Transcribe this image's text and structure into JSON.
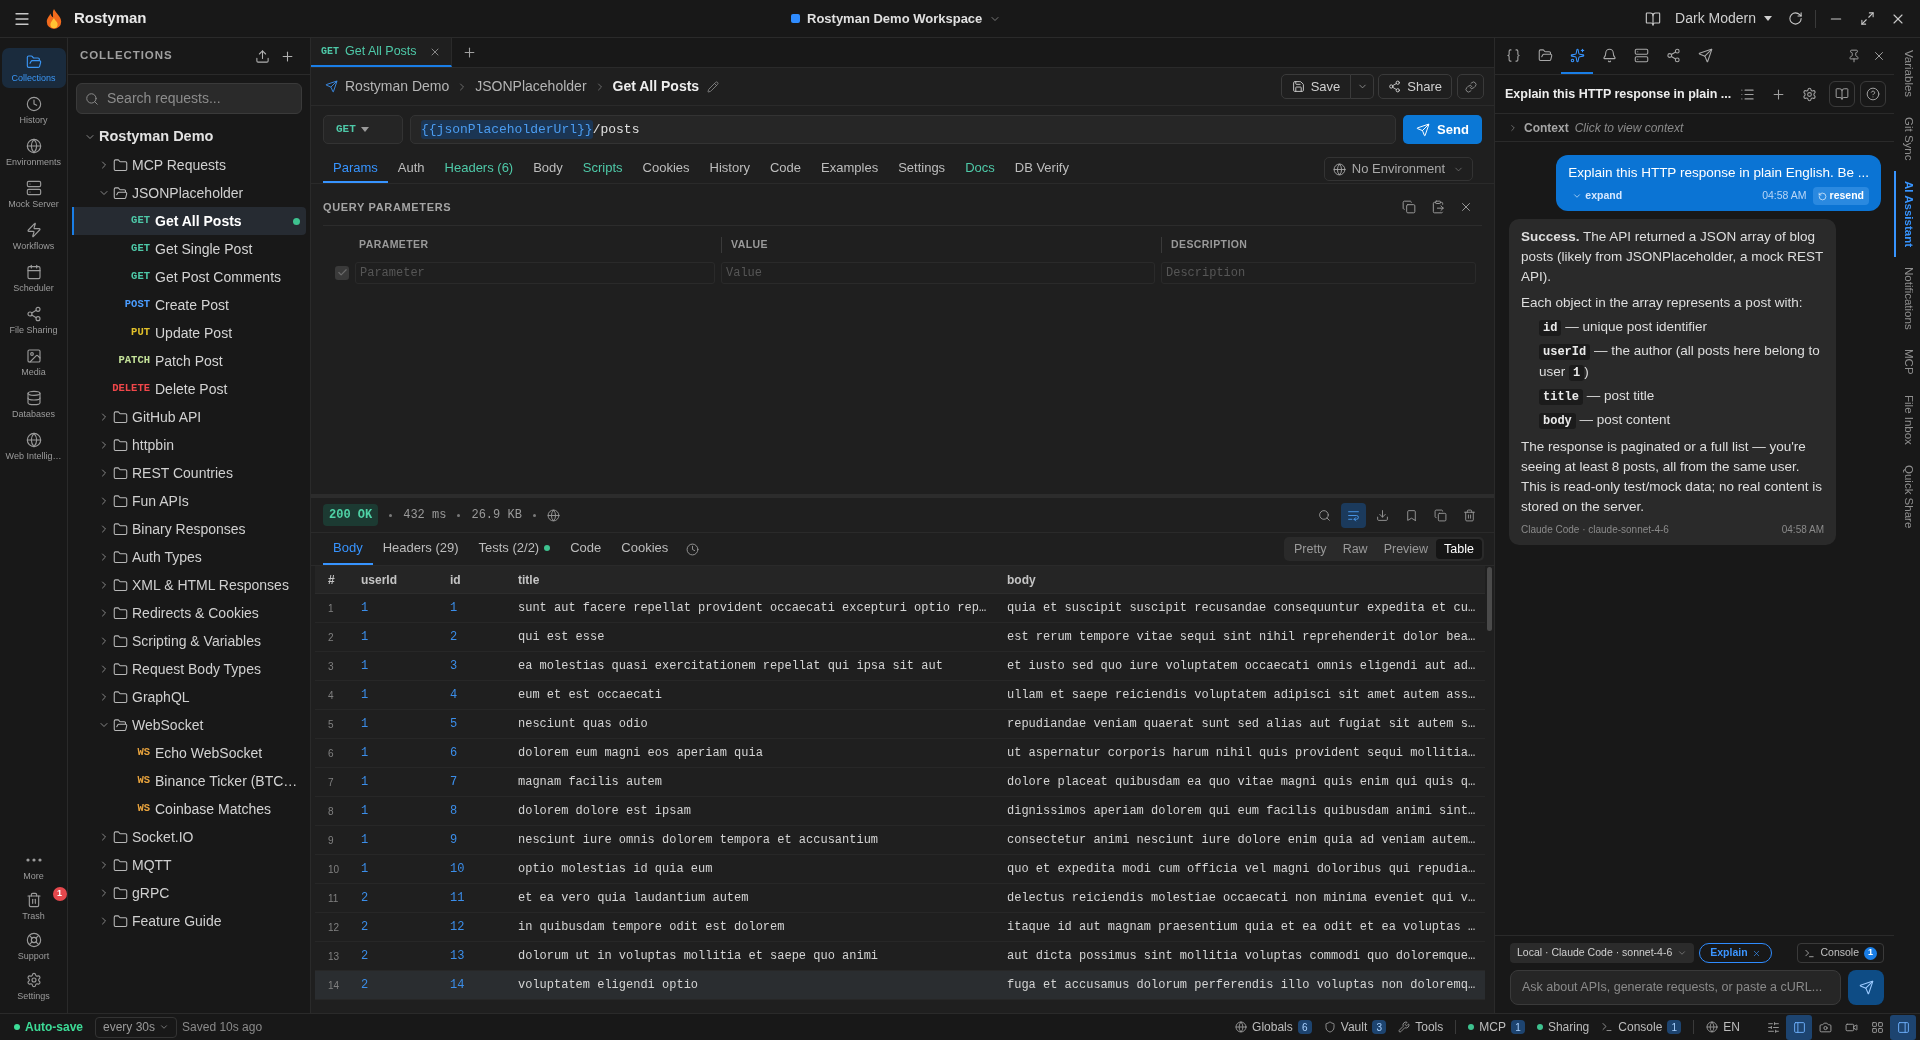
{
  "title_bar": {
    "app_name": "Rostyman",
    "workspace": "Rostyman Demo Workspace",
    "theme": "Dark Modern"
  },
  "activity_bar": {
    "items": [
      {
        "label": "Collections",
        "selected": true
      },
      {
        "label": "History",
        "selected": false
      },
      {
        "label": "Environments",
        "selected": false
      },
      {
        "label": "Mock Server",
        "selected": false
      },
      {
        "label": "Workflows",
        "selected": false
      },
      {
        "label": "Scheduler",
        "selected": false
      },
      {
        "label": "File Sharing",
        "selected": false
      },
      {
        "label": "Media",
        "selected": false
      },
      {
        "label": "Databases",
        "selected": false
      },
      {
        "label": "Web Intellig…",
        "selected": false
      }
    ],
    "bottom_items": [
      {
        "label": "More"
      },
      {
        "label": "Trash",
        "badge": "1"
      },
      {
        "label": "Support"
      },
      {
        "label": "Settings"
      }
    ]
  },
  "collections": {
    "title": "COLLECTIONS",
    "search_placeholder": "Search requests...",
    "tree": [
      {
        "kind": "collection",
        "label": "Rostyman Demo",
        "expanded": true,
        "children": [
          {
            "kind": "folder",
            "label": "MCP Requests",
            "expanded": false
          },
          {
            "kind": "folder",
            "label": "JSONPlaceholder",
            "expanded": true,
            "children": [
              {
                "kind": "request",
                "method": "GET",
                "color": "#4ec9a8",
                "label": "Get All Posts",
                "selected": true,
                "status_dot": true
              },
              {
                "kind": "request",
                "method": "GET",
                "color": "#4ec9a8",
                "label": "Get Single Post",
                "selected": false,
                "status_dot": false
              },
              {
                "kind": "request",
                "method": "GET",
                "color": "#4ec9a8",
                "label": "Get Post Comments",
                "selected": false,
                "status_dot": false
              },
              {
                "kind": "request",
                "method": "POST",
                "color": "#4b9dff",
                "label": "Create Post",
                "selected": false,
                "status_dot": false
              },
              {
                "kind": "request",
                "method": "PUT",
                "color": "#e2c12a",
                "label": "Update Post",
                "selected": false,
                "status_dot": false
              },
              {
                "kind": "request",
                "method": "PATCH",
                "color": "#c5e39a",
                "label": "Patch Post",
                "selected": false,
                "status_dot": false
              },
              {
                "kind": "request",
                "method": "DELETE",
                "color": "#f0474a",
                "label": "Delete Post",
                "selected": false,
                "status_dot": false
              }
            ]
          },
          {
            "kind": "folder",
            "label": "GitHub API",
            "expanded": false
          },
          {
            "kind": "folder",
            "label": "httpbin",
            "expanded": false
          },
          {
            "kind": "folder",
            "label": "REST Countries",
            "expanded": false
          },
          {
            "kind": "folder",
            "label": "Fun APIs",
            "expanded": false
          },
          {
            "kind": "folder",
            "label": "Binary Responses",
            "expanded": false
          },
          {
            "kind": "folder",
            "label": "Auth Types",
            "expanded": false
          },
          {
            "kind": "folder",
            "label": "XML & HTML Responses",
            "expanded": false
          },
          {
            "kind": "folder",
            "label": "Redirects & Cookies",
            "expanded": false
          },
          {
            "kind": "folder",
            "label": "Scripting & Variables",
            "expanded": false
          },
          {
            "kind": "folder",
            "label": "Request Body Types",
            "expanded": false
          },
          {
            "kind": "folder",
            "label": "GraphQL",
            "expanded": false
          },
          {
            "kind": "folder",
            "label": "WebSocket",
            "expanded": true,
            "children": [
              {
                "kind": "request",
                "method": "WS",
                "color": "#e8a33d",
                "label": "Echo WebSocket",
                "selected": false,
                "status_dot": false
              },
              {
                "kind": "request",
                "method": "WS",
                "color": "#e8a33d",
                "label": "Binance Ticker (BTC…",
                "selected": false,
                "status_dot": false
              },
              {
                "kind": "request",
                "method": "WS",
                "color": "#e8a33d",
                "label": "Coinbase Matches",
                "selected": false,
                "status_dot": false
              }
            ]
          },
          {
            "kind": "folder",
            "label": "Socket.IO",
            "expanded": false
          },
          {
            "kind": "folder",
            "label": "MQTT",
            "expanded": false
          },
          {
            "kind": "folder",
            "label": "gRPC",
            "expanded": false
          },
          {
            "kind": "folder",
            "label": "Feature Guide",
            "expanded": false
          }
        ]
      }
    ]
  },
  "open_tabs": [
    {
      "method": "GET",
      "label": "Get All Posts",
      "selected": true
    }
  ],
  "breadcrumb": {
    "items": [
      "Rostyman Demo",
      "JSONPlaceholder"
    ],
    "current": "Get All Posts"
  },
  "actions": {
    "save": "Save",
    "share": "Share"
  },
  "url_bar": {
    "method": "GET",
    "parts": [
      {
        "kind": "variable",
        "text": "{{jsonPlaceholderUrl}}"
      },
      {
        "kind": "text",
        "text": "/posts"
      }
    ],
    "send": "Send"
  },
  "request_sections": [
    {
      "label": "Params",
      "selected": true,
      "has_content": false
    },
    {
      "label": "Auth",
      "selected": false,
      "has_content": false
    },
    {
      "label": "Headers (6)",
      "selected": false,
      "has_content": true
    },
    {
      "label": "Body",
      "selected": false,
      "has_content": false
    },
    {
      "label": "Scripts",
      "selected": false,
      "has_content": true
    },
    {
      "label": "Cookies",
      "selected": false,
      "has_content": false
    },
    {
      "label": "History",
      "selected": false,
      "has_content": false
    },
    {
      "label": "Code",
      "selected": false,
      "has_content": false
    },
    {
      "label": "Examples",
      "selected": false,
      "has_content": false
    },
    {
      "label": "Settings",
      "selected": false,
      "has_content": false
    },
    {
      "label": "Docs",
      "selected": false,
      "has_content": true
    },
    {
      "label": "DB Verify",
      "selected": false,
      "has_content": false
    }
  ],
  "environment": "No Environment",
  "query_parameters": {
    "title": "QUERY PARAMETERS",
    "columns": [
      "PARAMETER",
      "VALUE",
      "DESCRIPTION"
    ],
    "new_row": {
      "checked": true,
      "placeholders": [
        "Parameter",
        "Value",
        "Description"
      ]
    }
  },
  "response": {
    "status": "200 OK",
    "time": "432 ms",
    "size": "26.9 KB",
    "word_wrap": true,
    "tabs": [
      {
        "label": "Body",
        "selected": true,
        "dot": false
      },
      {
        "label": "Headers (29)",
        "selected": false,
        "dot": false
      },
      {
        "label": "Tests (2/2)",
        "selected": false,
        "dot": true
      },
      {
        "label": "Code",
        "selected": false,
        "dot": false
      },
      {
        "label": "Cookies",
        "selected": false,
        "dot": false
      }
    ],
    "views": [
      {
        "label": "Pretty",
        "selected": false
      },
      {
        "label": "Raw",
        "selected": false
      },
      {
        "label": "Preview",
        "selected": false
      },
      {
        "label": "Table",
        "selected": true
      }
    ],
    "table": {
      "columns": [
        "#",
        "userId",
        "id",
        "title",
        "body"
      ],
      "rows": [
        {
          "cells": [
            "1",
            "1",
            "1",
            "sunt aut facere repellat provident occaecati excepturi optio rep…",
            "quia et suscipit suscipit recusandae consequuntur expedita et cu…"
          ],
          "highlighted": false
        },
        {
          "cells": [
            "2",
            "1",
            "2",
            "qui est esse",
            "est rerum tempore vitae sequi sint nihil reprehenderit dolor bea…"
          ],
          "highlighted": false
        },
        {
          "cells": [
            "3",
            "1",
            "3",
            "ea molestias quasi exercitationem repellat qui ipsa sit aut",
            "et iusto sed quo iure voluptatem occaecati omnis eligendi aut ad…"
          ],
          "highlighted": false
        },
        {
          "cells": [
            "4",
            "1",
            "4",
            "eum et est occaecati",
            "ullam et saepe reiciendis voluptatem adipisci sit amet autem ass…"
          ],
          "highlighted": false
        },
        {
          "cells": [
            "5",
            "1",
            "5",
            "nesciunt quas odio",
            "repudiandae veniam quaerat sunt sed alias aut fugiat sit autem s…"
          ],
          "highlighted": false
        },
        {
          "cells": [
            "6",
            "1",
            "6",
            "dolorem eum magni eos aperiam quia",
            "ut aspernatur corporis harum nihil quis provident sequi mollitia…"
          ],
          "highlighted": false
        },
        {
          "cells": [
            "7",
            "1",
            "7",
            "magnam facilis autem",
            "dolore placeat quibusdam ea quo vitae magni quis enim qui quis q…"
          ],
          "highlighted": false
        },
        {
          "cells": [
            "8",
            "1",
            "8",
            "dolorem dolore est ipsam",
            "dignissimos aperiam dolorem qui eum facilis quibusdam animi sint…"
          ],
          "highlighted": false
        },
        {
          "cells": [
            "9",
            "1",
            "9",
            "nesciunt iure omnis dolorem tempora et accusantium",
            "consectetur animi nesciunt iure dolore enim quia ad veniam autem…"
          ],
          "highlighted": false
        },
        {
          "cells": [
            "10",
            "1",
            "10",
            "optio molestias id quia eum",
            "quo et expedita modi cum officia vel magni doloribus qui repudia…"
          ],
          "highlighted": false
        },
        {
          "cells": [
            "11",
            "2",
            "11",
            "et ea vero quia laudantium autem",
            "delectus reiciendis molestiae occaecati non minima eveniet qui v…"
          ],
          "highlighted": false
        },
        {
          "cells": [
            "12",
            "2",
            "12",
            "in quibusdam tempore odit est dolorem",
            "itaque id aut magnam praesentium quia et ea odit et ea voluptas …"
          ],
          "highlighted": false
        },
        {
          "cells": [
            "13",
            "2",
            "13",
            "dolorum ut in voluptas mollitia et saepe quo animi",
            "aut dicta possimus sint mollitia voluptas commodi quo doloremque…"
          ],
          "highlighted": false
        },
        {
          "cells": [
            "14",
            "2",
            "14",
            "voluptatem eligendi optio",
            "fuga et accusamus dolorum perferendis illo voluptas non doloremq…"
          ],
          "highlighted": true
        }
      ]
    }
  },
  "ai_panel": {
    "tools": [
      {
        "selected": false
      },
      {
        "selected": false
      },
      {
        "selected": true
      },
      {
        "selected": false
      },
      {
        "selected": false
      },
      {
        "selected": false
      },
      {
        "selected": false
      }
    ],
    "chat_title": "Explain this HTTP response in plain ...",
    "context": {
      "label": "Context",
      "hint": "Click to view context",
      "expanded": false
    },
    "messages": [
      {
        "kind": "user",
        "text": "Explain this HTTP response in plain English. Be ...",
        "expand": "expand",
        "time": "04:58 AM",
        "resend": "resend"
      },
      {
        "kind": "assistant",
        "blocks": [
          {
            "kind": "paragraph",
            "text": "**Success.** The API returned a JSON array of blog posts (likely from JSONPlaceholder, a mock REST API)."
          },
          {
            "kind": "paragraph",
            "text": "Each object in the array represents a post with:"
          },
          {
            "kind": "list",
            "items": [
              {
                "parts": [
                  {
                    "kind": "code",
                    "text": "id"
                  },
                  {
                    "kind": "text",
                    "text": " — unique post identifier"
                  }
                ]
              },
              {
                "parts": [
                  {
                    "kind": "code",
                    "text": "userId"
                  },
                  {
                    "kind": "text",
                    "text": " — the author (all posts here belong to user "
                  },
                  {
                    "kind": "code",
                    "text": "1"
                  },
                  {
                    "kind": "text",
                    "text": ")"
                  }
                ]
              },
              {
                "parts": [
                  {
                    "kind": "code",
                    "text": "title"
                  },
                  {
                    "kind": "text",
                    "text": " — post title"
                  }
                ]
              },
              {
                "parts": [
                  {
                    "kind": "code",
                    "text": "body"
                  },
                  {
                    "kind": "text",
                    "text": " — post content"
                  }
                ]
              }
            ]
          },
          {
            "kind": "paragraph",
            "text": "The response is paginated or a full list — you're seeing at least 8 posts, all from the same user. This is read-only test/mock data; no real content is stored on the server."
          }
        ],
        "footer": "Claude Code · claude-sonnet-4-6",
        "time": "04:58 AM"
      }
    ],
    "composer": {
      "model": "Local · Claude Code · sonnet-4-6",
      "mode": "Explain",
      "console": "Console",
      "console_count": "1",
      "placeholder": "Ask about APIs, generate requests, or paste a cURL..."
    }
  },
  "side_tabs": [
    {
      "label": "Variables",
      "selected": false
    },
    {
      "label": "Git Sync",
      "selected": false
    },
    {
      "label": "AI Assistant",
      "selected": true
    },
    {
      "label": "Notifications",
      "selected": false
    },
    {
      "label": "MCP",
      "selected": false
    },
    {
      "label": "File Inbox",
      "selected": false
    },
    {
      "label": "Quick Share",
      "selected": false
    }
  ],
  "status_bar": {
    "autosave": "Auto-save",
    "autosave_on": true,
    "interval": "every 30s",
    "saved": "Saved 10s ago",
    "groups": [
      [
        {
          "label": "Globals",
          "count": "6",
          "dot": false
        },
        {
          "label": "Vault",
          "count": "3",
          "dot": false
        },
        {
          "label": "Tools",
          "dot": false
        }
      ],
      [
        {
          "label": "MCP",
          "count": "1",
          "dot": true
        },
        {
          "label": "Sharing",
          "dot": true
        },
        {
          "label": "Console",
          "count": "1",
          "dot": false
        }
      ],
      [
        {
          "label": "EN",
          "dot": false
        }
      ]
    ],
    "layout_toggles": [
      {
        "selected": false
      },
      {
        "selected": true
      },
      {
        "selected": false
      },
      {
        "selected": false
      },
      {
        "selected": false
      },
      {
        "selected": true
      }
    ]
  }
}
